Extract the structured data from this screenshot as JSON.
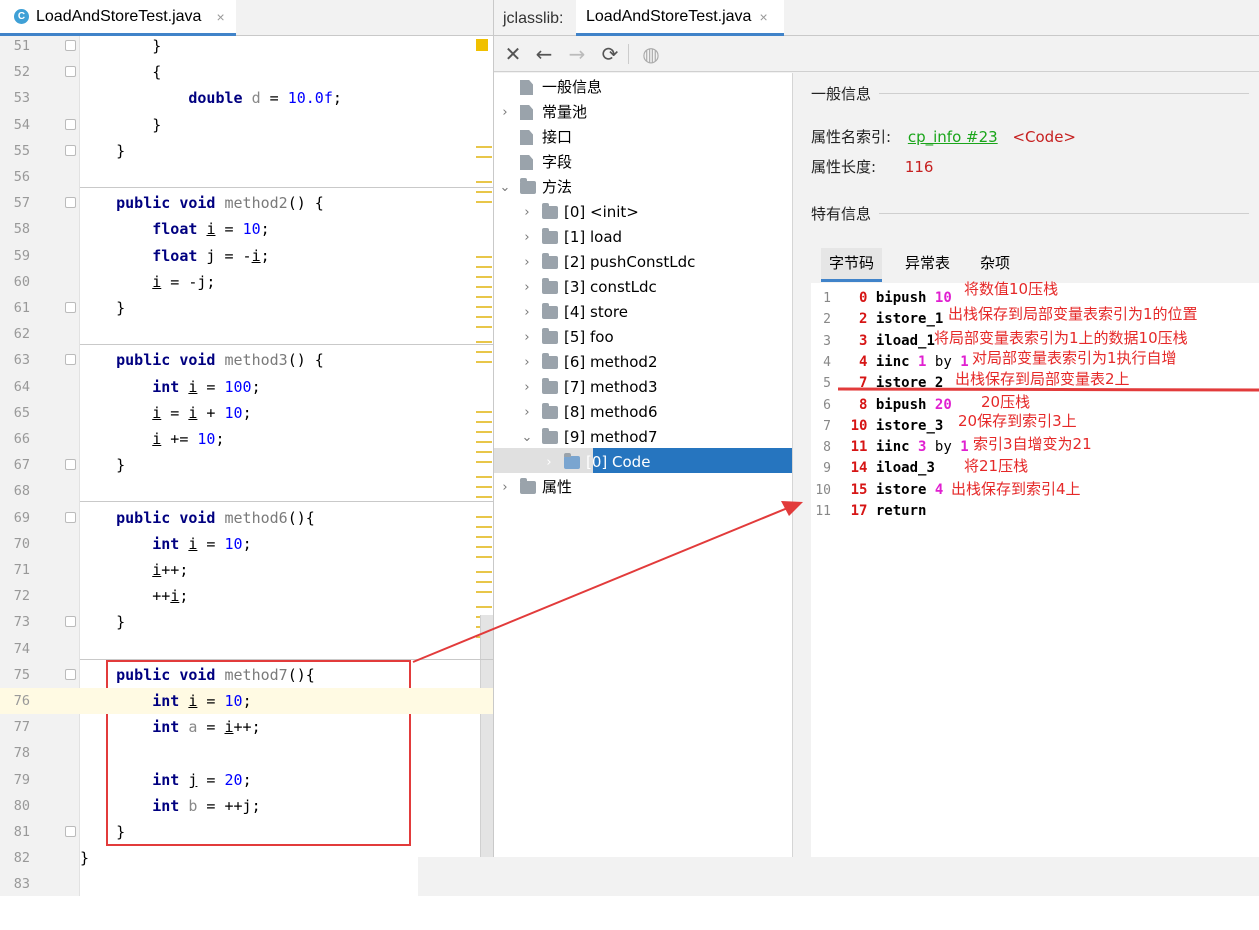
{
  "editor": {
    "tab_label": "LoadAndStoreTest.java",
    "tab_icon_letter": "C",
    "close_glyph": "×",
    "lines": [
      {
        "n": "51",
        "tokens": [
          [
            "p",
            "        }"
          ]
        ]
      },
      {
        "n": "52",
        "tokens": [
          [
            "p",
            "        {"
          ]
        ]
      },
      {
        "n": "53",
        "tokens": [
          [
            "p",
            "            "
          ],
          [
            "kw",
            "double"
          ],
          [
            "p",
            " "
          ],
          [
            "gr",
            "d"
          ],
          [
            "p",
            " = "
          ],
          [
            "num",
            "10.0f"
          ],
          [
            "p",
            ";"
          ]
        ]
      },
      {
        "n": "54",
        "tokens": [
          [
            "p",
            "        }"
          ]
        ]
      },
      {
        "n": "55",
        "tokens": [
          [
            "p",
            "    }"
          ]
        ]
      },
      {
        "n": "56",
        "tokens": []
      },
      {
        "n": "57",
        "tokens": [
          [
            "p",
            "    "
          ],
          [
            "kw",
            "public void"
          ],
          [
            "p",
            " "
          ],
          [
            "mn",
            "method2"
          ],
          [
            "p",
            "() {"
          ]
        ]
      },
      {
        "n": "58",
        "tokens": [
          [
            "p",
            "        "
          ],
          [
            "kw",
            "float"
          ],
          [
            "p",
            " "
          ],
          [
            "lv",
            "i"
          ],
          [
            "p",
            " = "
          ],
          [
            "num",
            "10"
          ],
          [
            "p",
            ";"
          ]
        ]
      },
      {
        "n": "59",
        "tokens": [
          [
            "p",
            "        "
          ],
          [
            "kw",
            "float"
          ],
          [
            "p",
            " j = -"
          ],
          [
            "lv",
            "i"
          ],
          [
            "p",
            ";"
          ]
        ]
      },
      {
        "n": "60",
        "tokens": [
          [
            "p",
            "        "
          ],
          [
            "lv",
            "i"
          ],
          [
            "p",
            " = -j;"
          ]
        ]
      },
      {
        "n": "61",
        "tokens": [
          [
            "p",
            "    }"
          ]
        ]
      },
      {
        "n": "62",
        "tokens": []
      },
      {
        "n": "63",
        "tokens": [
          [
            "p",
            "    "
          ],
          [
            "kw",
            "public void"
          ],
          [
            "p",
            " "
          ],
          [
            "mn",
            "method3"
          ],
          [
            "p",
            "() {"
          ]
        ]
      },
      {
        "n": "64",
        "tokens": [
          [
            "p",
            "        "
          ],
          [
            "kw",
            "int"
          ],
          [
            "p",
            " "
          ],
          [
            "lv",
            "i"
          ],
          [
            "p",
            " = "
          ],
          [
            "num",
            "100"
          ],
          [
            "p",
            ";"
          ]
        ]
      },
      {
        "n": "65",
        "tokens": [
          [
            "p",
            "        "
          ],
          [
            "lv",
            "i"
          ],
          [
            "p",
            " = "
          ],
          [
            "lv",
            "i"
          ],
          [
            "p",
            " + "
          ],
          [
            "num",
            "10"
          ],
          [
            "p",
            ";"
          ]
        ]
      },
      {
        "n": "66",
        "tokens": [
          [
            "p",
            "        "
          ],
          [
            "lv",
            "i"
          ],
          [
            "p",
            " += "
          ],
          [
            "num",
            "10"
          ],
          [
            "p",
            ";"
          ]
        ]
      },
      {
        "n": "67",
        "tokens": [
          [
            "p",
            "    }"
          ]
        ]
      },
      {
        "n": "68",
        "tokens": []
      },
      {
        "n": "69",
        "tokens": [
          [
            "p",
            "    "
          ],
          [
            "kw",
            "public void"
          ],
          [
            "p",
            " "
          ],
          [
            "mn",
            "method6"
          ],
          [
            "p",
            "(){"
          ]
        ]
      },
      {
        "n": "70",
        "tokens": [
          [
            "p",
            "        "
          ],
          [
            "kw",
            "int"
          ],
          [
            "p",
            " "
          ],
          [
            "lv",
            "i"
          ],
          [
            "p",
            " = "
          ],
          [
            "num",
            "10"
          ],
          [
            "p",
            ";"
          ]
        ]
      },
      {
        "n": "71",
        "tokens": [
          [
            "p",
            "        "
          ],
          [
            "lv",
            "i"
          ],
          [
            "p",
            "++;"
          ]
        ]
      },
      {
        "n": "72",
        "tokens": [
          [
            "p",
            "        ++"
          ],
          [
            "lv",
            "i"
          ],
          [
            "p",
            ";"
          ]
        ]
      },
      {
        "n": "73",
        "tokens": [
          [
            "p",
            "    }"
          ]
        ]
      },
      {
        "n": "74",
        "tokens": []
      },
      {
        "n": "75",
        "tokens": [
          [
            "p",
            "    "
          ],
          [
            "kw",
            "public void"
          ],
          [
            "p",
            " "
          ],
          [
            "mn",
            "method7"
          ],
          [
            "p",
            "(){"
          ]
        ]
      },
      {
        "n": "76",
        "tokens": [
          [
            "p",
            "        "
          ],
          [
            "kw",
            "int"
          ],
          [
            "p",
            " "
          ],
          [
            "lv",
            "i"
          ],
          [
            "p",
            " = "
          ],
          [
            "num",
            "10"
          ],
          [
            "p",
            ";"
          ]
        ]
      },
      {
        "n": "77",
        "tokens": [
          [
            "p",
            "        "
          ],
          [
            "kw",
            "int"
          ],
          [
            "p",
            " "
          ],
          [
            "gr",
            "a"
          ],
          [
            "p",
            " = "
          ],
          [
            "lv",
            "i"
          ],
          [
            "p",
            "++;"
          ]
        ]
      },
      {
        "n": "78",
        "tokens": []
      },
      {
        "n": "79",
        "tokens": [
          [
            "p",
            "        "
          ],
          [
            "kw",
            "int"
          ],
          [
            "p",
            " "
          ],
          [
            "lv",
            "j"
          ],
          [
            "p",
            " = "
          ],
          [
            "num",
            "20"
          ],
          [
            "p",
            ";"
          ]
        ]
      },
      {
        "n": "80",
        "tokens": [
          [
            "p",
            "        "
          ],
          [
            "kw",
            "int"
          ],
          [
            "p",
            " "
          ],
          [
            "gr",
            "b"
          ],
          [
            "p",
            " = ++j;"
          ]
        ]
      },
      {
        "n": "81",
        "tokens": [
          [
            "p",
            "    }"
          ]
        ]
      },
      {
        "n": "82",
        "tokens": [
          [
            "p",
            "}"
          ]
        ]
      },
      {
        "n": "83",
        "tokens": []
      }
    ]
  },
  "jclasslib": {
    "label": "jclasslib:",
    "tab_label": "LoadAndStoreTest.java",
    "close_glyph": "×",
    "toolbar": {
      "close": "✕",
      "back": "←",
      "forward": "→",
      "refresh": "⟳",
      "web": "◍"
    },
    "tree": [
      {
        "label": "一般信息",
        "arrow": "",
        "icon": "doc-icon",
        "level": 0
      },
      {
        "label": "常量池",
        "arrow": "›",
        "icon": "doc-icon",
        "level": 0
      },
      {
        "label": "接口",
        "arrow": "",
        "icon": "doc-icon",
        "level": 0
      },
      {
        "label": "字段",
        "arrow": "",
        "icon": "doc-icon",
        "level": 0
      },
      {
        "label": "方法",
        "arrow": "⌄",
        "icon": "folder-icon",
        "level": 0
      },
      {
        "label": "[0] <init>",
        "arrow": "›",
        "icon": "folder-icon",
        "level": 1
      },
      {
        "label": "[1] load",
        "arrow": "›",
        "icon": "folder-icon",
        "level": 1
      },
      {
        "label": "[2] pushConstLdc",
        "arrow": "›",
        "icon": "folder-icon",
        "level": 1
      },
      {
        "label": "[3] constLdc",
        "arrow": "›",
        "icon": "folder-icon",
        "level": 1
      },
      {
        "label": "[4] store",
        "arrow": "›",
        "icon": "folder-icon",
        "level": 1
      },
      {
        "label": "[5] foo",
        "arrow": "›",
        "icon": "folder-icon",
        "level": 1
      },
      {
        "label": "[6] method2",
        "arrow": "›",
        "icon": "folder-icon",
        "level": 1
      },
      {
        "label": "[7] method3",
        "arrow": "›",
        "icon": "folder-icon",
        "level": 1
      },
      {
        "label": "[8] method6",
        "arrow": "›",
        "icon": "folder-icon",
        "level": 1
      },
      {
        "label": "[9] method7",
        "arrow": "⌄",
        "icon": "folder-icon",
        "level": 1
      },
      {
        "label": "[0] Code",
        "arrow": "›",
        "icon": "folder-icon",
        "level": 2,
        "selected": true
      },
      {
        "label": "属性",
        "arrow": "›",
        "icon": "folder-icon",
        "level": 0
      }
    ],
    "detail": {
      "general_header": "一般信息",
      "name_index_label": "属性名索引:",
      "name_index_link": "cp_info #23",
      "name_index_value": "<Code>",
      "length_label": "属性长度:",
      "length_value": "116",
      "specific_header": "特有信息",
      "tabs": [
        "字节码",
        "异常表",
        "杂项"
      ],
      "bytecode": [
        {
          "ln": "1",
          "off": "0",
          "op": "bipush",
          "args": [
            [
              "bnum",
              "10"
            ]
          ]
        },
        {
          "ln": "2",
          "off": "2",
          "op": "istore_1",
          "args": []
        },
        {
          "ln": "3",
          "off": "3",
          "op": "iload_1",
          "args": []
        },
        {
          "ln": "4",
          "off": "4",
          "op": "iinc",
          "args": [
            [
              "bnum",
              "1"
            ],
            [
              "bby",
              "by"
            ],
            [
              "bnum",
              "1"
            ]
          ]
        },
        {
          "ln": "5",
          "off": "7",
          "op": "istore_2",
          "args": []
        },
        {
          "ln": "6",
          "off": "8",
          "op": "bipush",
          "args": [
            [
              "bnum",
              "20"
            ]
          ]
        },
        {
          "ln": "7",
          "off": "10",
          "op": "istore_3",
          "args": []
        },
        {
          "ln": "8",
          "off": "11",
          "op": "iinc",
          "args": [
            [
              "bnum",
              "3"
            ],
            [
              "bby",
              "by"
            ],
            [
              "bnum",
              "1"
            ]
          ]
        },
        {
          "ln": "9",
          "off": "14",
          "op": "iload_3",
          "args": []
        },
        {
          "ln": "10",
          "off": "15",
          "op": "istore",
          "args": [
            [
              "bnum",
              "4"
            ]
          ]
        },
        {
          "ln": "11",
          "off": "17",
          "op": "return",
          "args": []
        }
      ],
      "annotations": [
        "将数值10压栈",
        "出栈保存到局部变量表索引为1的位置",
        "将局部变量表索引为1上的数据10压栈",
        "对局部变量表索引为1执行自增",
        "出栈保存到局部变量表2上",
        "20压栈",
        "20保存到索引3上",
        "索引3自增变为21",
        "将21压栈",
        "出栈保存到索引4上"
      ]
    }
  },
  "colors": {
    "annotation": "#e52828",
    "selection": "#2675bf",
    "keyword": "#000080",
    "number": "#0000ff",
    "offset": "#d61515",
    "operand": "#e020d0"
  }
}
